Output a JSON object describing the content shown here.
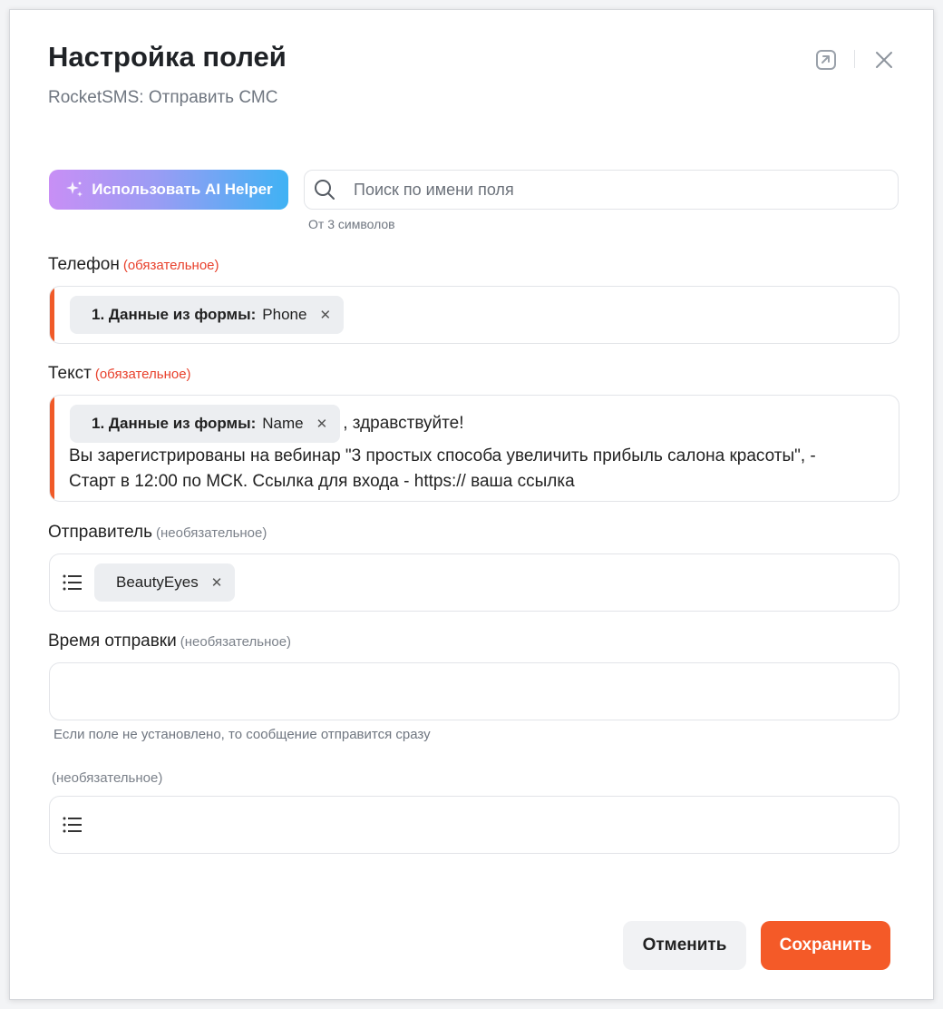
{
  "header": {
    "title": "Настройка полей",
    "subtitle": "RocketSMS: Отправить СМС",
    "icons": [
      "expand-icon",
      "close-icon"
    ]
  },
  "ai_helper": {
    "label": "Использовать AI Helper",
    "icon": "sparkles-icon"
  },
  "search": {
    "placeholder": "Поиск по имени поля",
    "value": "",
    "hint": "От 3 символов",
    "icon": "search-icon"
  },
  "fields": {
    "phone": {
      "label": "Телефон",
      "badge": "(обязательное)",
      "chip_source": "1. Данные из формы:",
      "chip_value": "Phone",
      "chip_remove": "✕"
    },
    "text": {
      "label": "Текст",
      "badge": "(обязательное)",
      "chip_source": "1. Данные из формы:",
      "chip_value": "Name",
      "chip_remove": "✕",
      "after_chip": ", здравствуйте!",
      "body": "Вы зарегистрированы на вебинар \"3 простых способа увеличить прибыль салона красоты\", - Старт в 12:00 по МСК. Ссылка для входа - https:// ваша ссылка"
    },
    "sender": {
      "label": "Отправитель",
      "badge": "(необязательное)",
      "chip_value": "BeautyEyes",
      "chip_remove": "✕",
      "icon": "list-icon"
    },
    "send_time": {
      "label": "Время отправки",
      "badge": "(необязательное)",
      "value": "",
      "hint": "Если поле не установлено, то сообщение отправится сразу"
    },
    "extra": {
      "label": "",
      "badge": "(необязательное)",
      "icon": "list-icon"
    }
  },
  "footer": {
    "cancel_label": "Отменить",
    "save_label": "Сохранить"
  },
  "colors": {
    "accent": "#f45a28",
    "required": "#e8412c",
    "ai_gradient_start": "#c88ff5",
    "ai_gradient_end": "#3fb2f4"
  }
}
